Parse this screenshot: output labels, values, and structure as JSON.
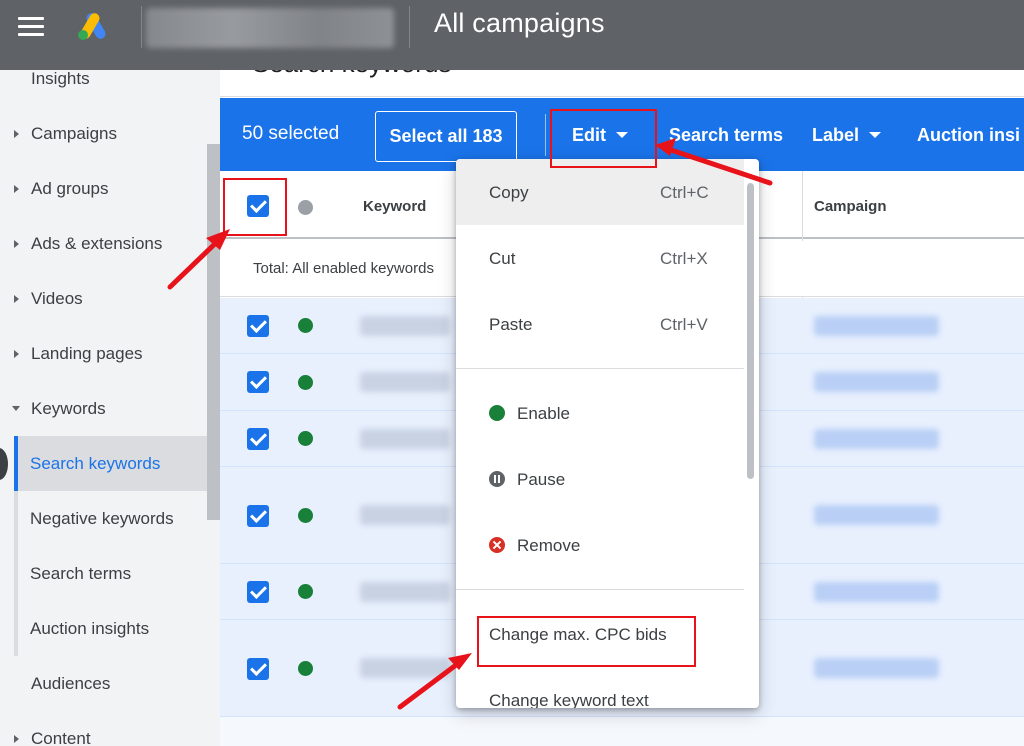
{
  "header": {
    "title": "All campaigns"
  },
  "sidebar": {
    "items": [
      {
        "label": "Insights",
        "caret": "none"
      },
      {
        "label": "Campaigns",
        "caret": "right"
      },
      {
        "label": "Ad groups",
        "caret": "right"
      },
      {
        "label": "Ads & extensions",
        "caret": "right"
      },
      {
        "label": "Videos",
        "caret": "right"
      },
      {
        "label": "Landing pages",
        "caret": "right"
      },
      {
        "label": "Keywords",
        "caret": "down"
      },
      {
        "label": "Search keywords",
        "active": true
      },
      {
        "label": "Negative keywords"
      },
      {
        "label": "Search terms"
      },
      {
        "label": "Auction insights"
      },
      {
        "label": "Audiences",
        "caret": "none"
      },
      {
        "label": "Content",
        "caret": "right"
      }
    ]
  },
  "page": {
    "heading": "Search keywords"
  },
  "selection_bar": {
    "selected_count": "50 selected",
    "select_all": "Select all 183",
    "edit": "Edit",
    "search_terms": "Search terms",
    "label": "Label",
    "auction": "Auction insi"
  },
  "table": {
    "headers": {
      "keyword": "Keyword",
      "campaign": "Campaign"
    },
    "total": "Total: All enabled keywords",
    "rows": [
      {
        "checked": true,
        "status": "enabled"
      },
      {
        "checked": true,
        "status": "enabled"
      },
      {
        "checked": true,
        "status": "enabled"
      },
      {
        "checked": true,
        "status": "enabled"
      },
      {
        "checked": true,
        "status": "enabled"
      },
      {
        "checked": true,
        "status": "enabled"
      }
    ]
  },
  "edit_menu": {
    "copy": {
      "label": "Copy",
      "shortcut": "Ctrl+C"
    },
    "cut": {
      "label": "Cut",
      "shortcut": "Ctrl+X"
    },
    "paste": {
      "label": "Paste",
      "shortcut": "Ctrl+V"
    },
    "enable": {
      "label": "Enable",
      "icon": "enabled-dot-icon"
    },
    "pause": {
      "label": "Pause",
      "icon": "pause-icon"
    },
    "remove": {
      "label": "Remove",
      "icon": "remove-icon"
    },
    "change_bids": {
      "label": "Change max. CPC bids"
    },
    "change_text": {
      "label": "Change keyword text"
    }
  },
  "colors": {
    "appbar": "#5f6368",
    "primary": "#1a73e8",
    "enabled": "#188038",
    "remove": "#d93025",
    "annotation": "#e8121b"
  }
}
